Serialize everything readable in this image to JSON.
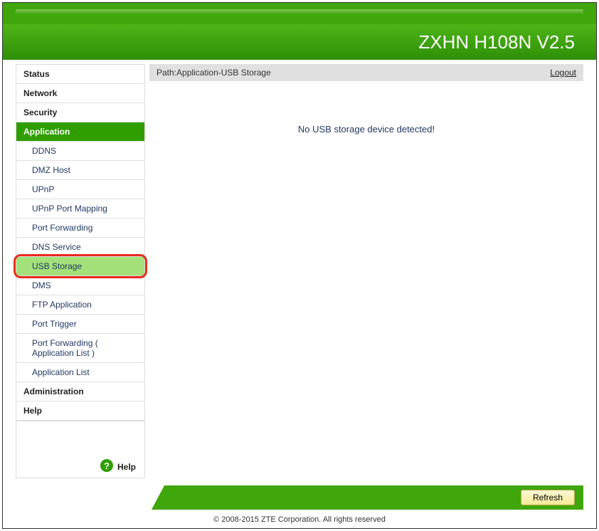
{
  "header": {
    "device_title": "ZXHN H108N V2.5"
  },
  "sidebar": {
    "top": [
      {
        "label": "Status",
        "active": false
      },
      {
        "label": "Network",
        "active": false
      },
      {
        "label": "Security",
        "active": false
      },
      {
        "label": "Application",
        "active": true
      }
    ],
    "sub": [
      {
        "label": "DDNS"
      },
      {
        "label": "DMZ Host"
      },
      {
        "label": "UPnP"
      },
      {
        "label": "UPnP Port Mapping"
      },
      {
        "label": "Port Forwarding"
      },
      {
        "label": "DNS Service"
      },
      {
        "label": "USB Storage",
        "active": true,
        "highlight": true
      },
      {
        "label": "DMS"
      },
      {
        "label": "FTP Application"
      },
      {
        "label": "Port Trigger"
      },
      {
        "label": "Port Forwarding ( Application List )"
      },
      {
        "label": "Application List"
      }
    ],
    "bottom": [
      {
        "label": "Administration"
      },
      {
        "label": "Help"
      }
    ],
    "help_link": "Help",
    "help_glyph": "?"
  },
  "main": {
    "path_prefix": "Path:",
    "path_value": "Application-USB Storage",
    "logout_label": "Logout",
    "message": "No USB storage device detected!"
  },
  "footer": {
    "refresh_label": "Refresh",
    "copyright": "© 2008-2015 ZTE Corporation. All rights reserved"
  }
}
